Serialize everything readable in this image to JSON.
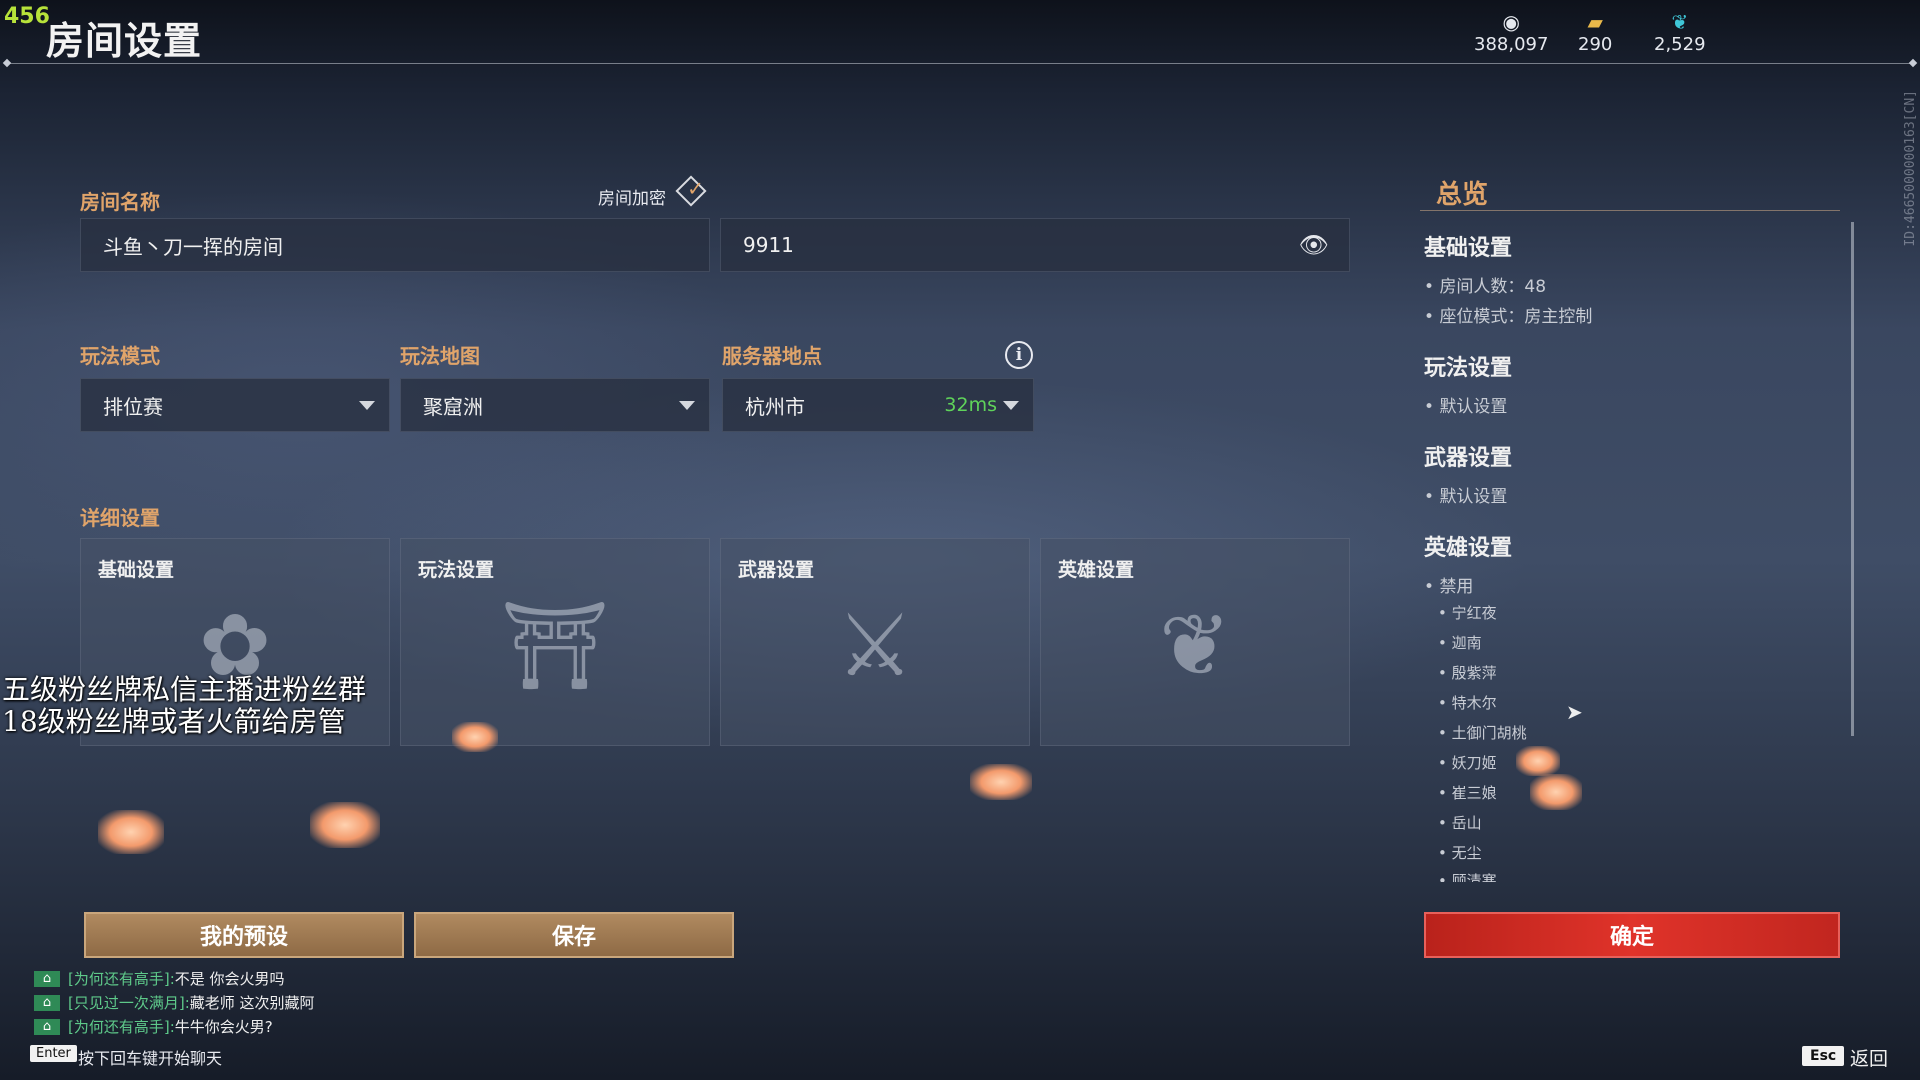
{
  "overlay": {
    "fps": "456",
    "line1": "五级粉丝牌私信主播进粉丝群",
    "line2": "18级粉丝牌或者火箭给房管"
  },
  "header": {
    "title": "房间设置",
    "currencies": [
      {
        "icon": "coin-icon",
        "value": "388,097"
      },
      {
        "icon": "gold-bar-icon",
        "value": "290"
      },
      {
        "icon": "feather-icon",
        "value": "2,529"
      }
    ],
    "side_id": "ID:4665000000163[CN]"
  },
  "room": {
    "name_label": "房间名称",
    "name_value": "斗鱼丶刀一挥的房间",
    "password_label": "房间加密",
    "password_value": "9911"
  },
  "mode": {
    "label": "玩法模式",
    "value": "排位赛"
  },
  "map": {
    "label": "玩法地图",
    "value": "聚窟洲"
  },
  "server": {
    "label": "服务器地点",
    "value": "杭州市",
    "ping": "32ms",
    "ping_color": "#5fd35a"
  },
  "details": {
    "label": "详细设置",
    "cards": [
      {
        "title": "基础设置",
        "icon": "flower-icon"
      },
      {
        "title": "玩法设置",
        "icon": "pavilion-icon"
      },
      {
        "title": "武器设置",
        "icon": "swords-icon"
      },
      {
        "title": "英雄设置",
        "icon": "mask-icon"
      }
    ]
  },
  "buttons": {
    "preset": "我的预设",
    "save": "保存",
    "confirm": "确定"
  },
  "summary": {
    "title": "总览",
    "basic": {
      "title": "基础设置",
      "players": "房间人数：48",
      "seat": "座位模式：房主控制"
    },
    "gameplay": {
      "title": "玩法设置",
      "value": "默认设置"
    },
    "weapon": {
      "title": "武器设置",
      "value": "默认设置"
    },
    "hero": {
      "title": "英雄设置",
      "banned_label": "禁用",
      "banned": [
        "宁红夜",
        "迦南",
        "殷紫萍",
        "特木尔",
        "土御门胡桃",
        "妖刀姬",
        "崔三娘",
        "岳山",
        "无尘",
        "顾清寒"
      ]
    }
  },
  "chat": {
    "messages": [
      {
        "name": "[为何还有高手]:",
        "text": "不是  你会火男吗"
      },
      {
        "name": "[只见过一次满月]:",
        "text": "藏老师 这次别藏阿"
      },
      {
        "name": "[为何还有高手]:",
        "text": "牛牛你会火男?"
      }
    ],
    "enter_key": "Enter",
    "enter_hint": "按下回车键开始聊天"
  },
  "footer": {
    "esc_key": "Esc",
    "back": "返回"
  },
  "colors": {
    "accent_orange": "#e0a46a",
    "confirm_red": "#d42c24",
    "preset_brown": "#9c7650"
  }
}
